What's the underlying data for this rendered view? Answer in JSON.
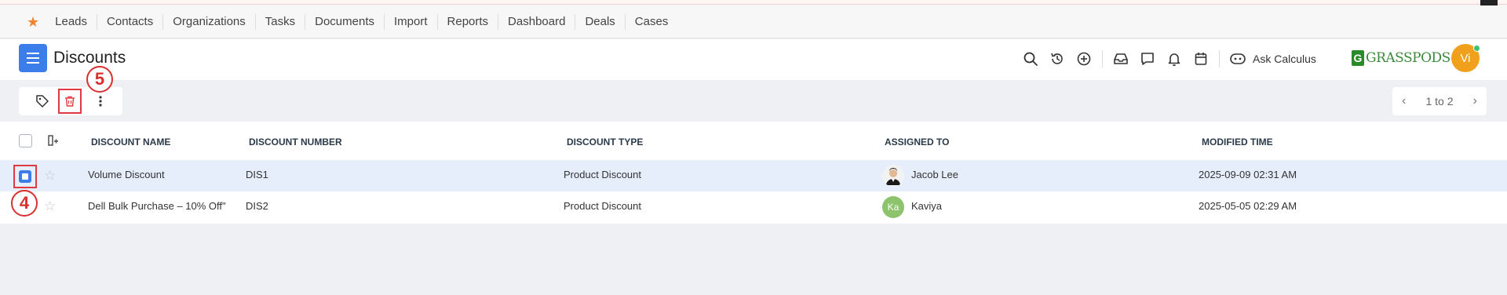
{
  "nav": {
    "items": [
      "Leads",
      "Contacts",
      "Organizations",
      "Tasks",
      "Documents",
      "Import",
      "Reports",
      "Dashboard",
      "Deals",
      "Cases"
    ]
  },
  "header": {
    "title": "Discounts",
    "ask_label": "Ask Calculus",
    "logo_text": "GRASSPODS",
    "logo_letter": "G",
    "avatar_initials": "Vi",
    "icons": [
      "search-icon",
      "history-icon",
      "add-circle-icon",
      "inbox-icon",
      "chat-icon",
      "bell-icon",
      "calendar-icon",
      "ai-bot-icon"
    ]
  },
  "toolbar": {
    "icons": [
      "tag-icon",
      "trash-icon",
      "more-vertical-icon"
    ]
  },
  "annotations": {
    "badge_delete": "5",
    "badge_checkbox": "4"
  },
  "pager": {
    "label": "1 to 2"
  },
  "table": {
    "columns": [
      "DISCOUNT NAME",
      "DISCOUNT NUMBER",
      "DISCOUNT TYPE",
      "ASSIGNED TO",
      "MODIFIED TIME"
    ],
    "rows": [
      {
        "name": "Volume Discount",
        "number": "DIS1",
        "type": "Product Discount",
        "assigned": "Jacob Lee",
        "assigned_initials": "",
        "modified": "2025-09-09 02:31 AM",
        "selected": true
      },
      {
        "name": "Dell Bulk Purchase – 10% Off\"",
        "number": "DIS2",
        "type": "Product Discount",
        "assigned": "Kaviya",
        "assigned_initials": "Ka",
        "modified": "2025-05-05 02:29 AM",
        "selected": false
      }
    ]
  },
  "colors": {
    "accent": "#3b7de9",
    "highlight_red": "#e0393f",
    "star_orange": "#f2852e",
    "avatar_orange": "#f0a01a",
    "logo_green": "#2a8a2a",
    "selected_row": "#e6eefb"
  }
}
